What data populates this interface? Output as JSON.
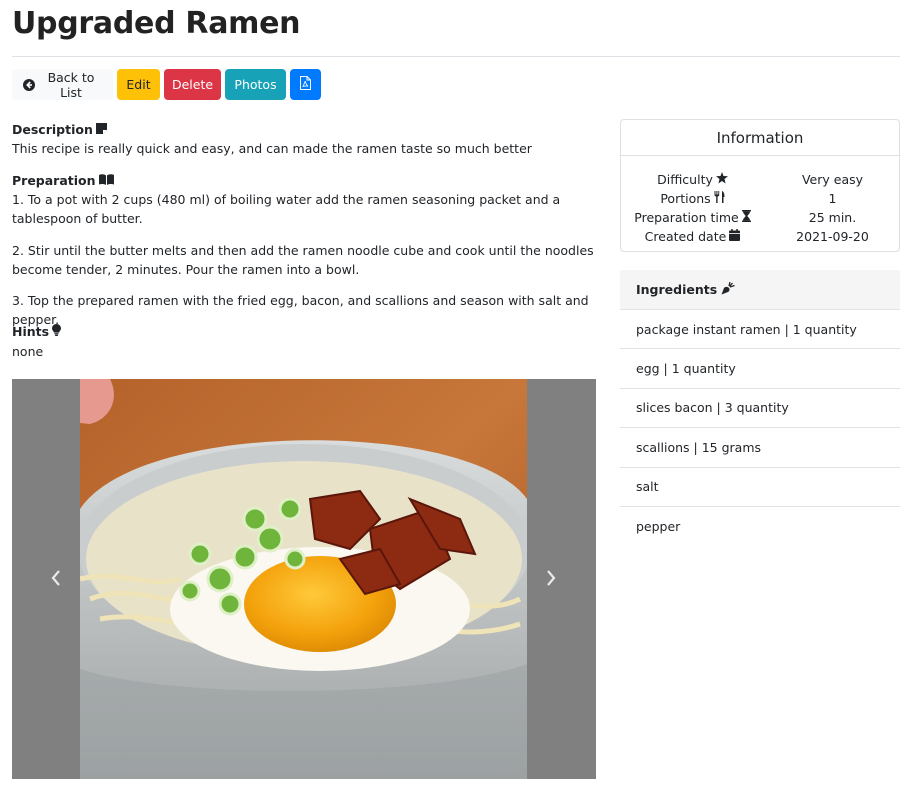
{
  "page": {
    "title": "Upgraded Ramen"
  },
  "toolbar": {
    "back_label": "Back to List",
    "edit_label": "Edit",
    "delete_label": "Delete",
    "photos_label": "Photos",
    "pdf_icon": "file-pdf-icon",
    "back_icon": "arrow-circle-left-icon"
  },
  "description": {
    "heading": "Description",
    "icon": "sticky-note-icon",
    "text": "This recipe is really quick and easy, and can made the ramen taste so much better"
  },
  "preparation": {
    "heading": "Preparation",
    "icon": "book-open-icon",
    "steps": [
      "1. To a pot with 2 cups (480 ml) of boiling water add the ramen seasoning packet and a tablespoon of butter.",
      "2. Stir until the butter melts and then add the ramen noodle cube and cook until the noodles become tender, 2 minutes. Pour the ramen into a bowl.",
      "3. Top the prepared ramen with the fried egg, bacon, and scallions and season with salt and pepper."
    ]
  },
  "hints": {
    "heading": "Hints",
    "icon": "lightbulb-icon",
    "text": "none"
  },
  "carousel": {
    "prev_icon": "chevron-left-icon",
    "next_icon": "chevron-right-icon"
  },
  "information": {
    "heading": "Information",
    "rows": [
      {
        "label": "Difficulty",
        "icon": "star-icon",
        "value": "Very easy"
      },
      {
        "label": "Portions",
        "icon": "utensils-icon",
        "value": "1"
      },
      {
        "label": "Preparation time",
        "icon": "hourglass-icon",
        "value": "25 min."
      },
      {
        "label": "Created date",
        "icon": "calendar-icon",
        "value": "2021-09-20"
      }
    ]
  },
  "ingredients": {
    "heading": "Ingredients",
    "icon": "carrot-icon",
    "items": [
      "package instant ramen | 1 quantity",
      "egg | 1 quantity",
      "slices bacon | 3 quantity",
      "scallions | 15 grams",
      "salt",
      "pepper"
    ]
  },
  "colors": {
    "warning": "#ffc107",
    "danger": "#dc3545",
    "info": "#17a2b8",
    "primary": "#007bff",
    "light": "#f8f9fa",
    "carousel_bg": "#808080"
  }
}
